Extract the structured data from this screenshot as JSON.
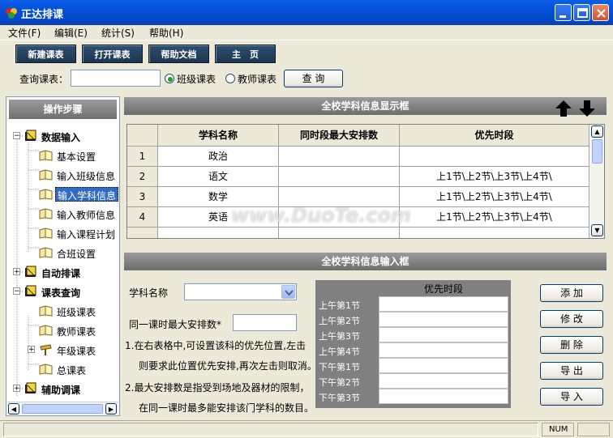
{
  "window": {
    "title": "正达排课"
  },
  "menu": [
    "文件(F)",
    "编辑(E)",
    "统计(S)",
    "帮助(H)"
  ],
  "toolbar": {
    "new": "新建课表",
    "open": "打开课表",
    "help": "帮助文档",
    "home": "主　页"
  },
  "search": {
    "label": "查询课表：",
    "value": "",
    "radio_class": "班级课表",
    "radio_teacher": "教师课表",
    "selected": "班级课表",
    "button": "查 询"
  },
  "sidebar": {
    "header": "操作步骤",
    "groups": [
      {
        "label": "数据输入",
        "expanded": true,
        "children": [
          "基本设置",
          "输入班级信息",
          "输入学科信息",
          "输入教师信息",
          "输入课程计划",
          "合班设置"
        ]
      },
      {
        "label": "自动排课",
        "expanded": false,
        "children": []
      },
      {
        "label": "课表查询",
        "expanded": true,
        "children": [
          "班级课表",
          "教师课表",
          "年级课表",
          "总课表"
        ]
      },
      {
        "label": "辅助调课",
        "expanded": false,
        "children": []
      }
    ],
    "selected": "输入学科信息"
  },
  "display": {
    "title": "全校学科信息显示框",
    "columns": [
      "学科名称",
      "同时段最大安排数",
      "优先时段"
    ],
    "rows": [
      {
        "n": "1",
        "name": "政治",
        "max": "",
        "pref": ""
      },
      {
        "n": "2",
        "name": "语文",
        "max": "",
        "pref": "上1节\\上2节\\上3节\\上4节\\"
      },
      {
        "n": "3",
        "name": "数学",
        "max": "",
        "pref": "上1节\\上2节\\上3节\\上4节\\"
      },
      {
        "n": "4",
        "name": "英语",
        "max": "",
        "pref": "上1节\\上2节\\上3节\\上4节\\"
      }
    ]
  },
  "input": {
    "title": "全校学科信息输入框",
    "subject_label": "学科名称",
    "subject_value": "",
    "max_label": "同一课时最大安排数*",
    "max_value": "",
    "note1a": "1.在右表格中,可设置该科的优先位置,左击",
    "note1b": "则要求此位置优先安排,再次左击则取消。",
    "note2a": "2.最大安排数是指受到场地及器材的限制，",
    "note2b": "在同一课时最多能安排该门学科的数目。",
    "pref_header": "优先时段",
    "periods": [
      "上午第1节",
      "上午第2节",
      "上午第3节",
      "上午第4节",
      "下午第1节",
      "下午第2节",
      "下午第3节"
    ],
    "buttons": {
      "add": "添 加",
      "edit": "修 改",
      "delete": "删 除",
      "export": "导 出",
      "import": "导 入"
    }
  },
  "status": {
    "num": "NUM"
  },
  "watermark": "www.DuoTe.com"
}
